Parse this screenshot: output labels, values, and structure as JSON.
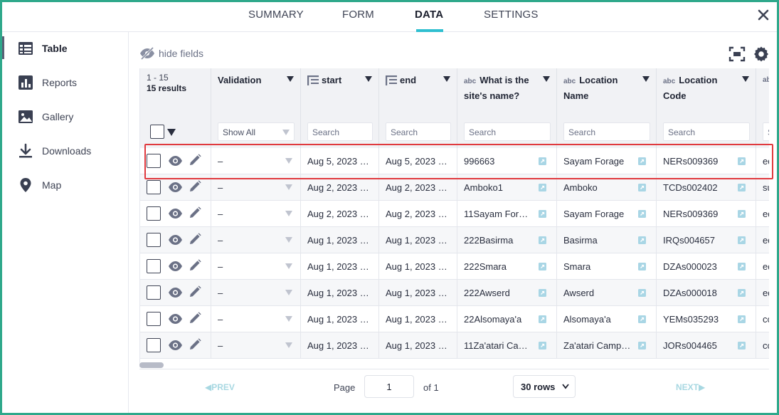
{
  "tabs": [
    {
      "label": "SUMMARY",
      "active": false
    },
    {
      "label": "FORM",
      "active": false
    },
    {
      "label": "DATA",
      "active": true
    },
    {
      "label": "SETTINGS",
      "active": false
    }
  ],
  "sidebar": {
    "items": [
      {
        "label": "Table",
        "icon": "table-icon",
        "active": true
      },
      {
        "label": "Reports",
        "icon": "reports-icon",
        "active": false
      },
      {
        "label": "Gallery",
        "icon": "gallery-icon",
        "active": false
      },
      {
        "label": "Downloads",
        "icon": "download-icon",
        "active": false
      },
      {
        "label": "Map",
        "icon": "map-pin-icon",
        "active": false
      }
    ]
  },
  "toolbar": {
    "hide_fields_label": "hide fields",
    "hide_fields_icon": "eye-off-icon",
    "fullscreen_icon": "fullscreen-icon",
    "settings_icon": "gear-icon"
  },
  "table": {
    "range": "1 - 15",
    "results": "15 results",
    "columns": [
      {
        "key": "validation",
        "title": "Validation",
        "filter": "Show All",
        "type": "select"
      },
      {
        "key": "start",
        "title": "start",
        "filter": "Search",
        "type": "datetime"
      },
      {
        "key": "end",
        "title": "end",
        "filter": "Search",
        "type": "datetime"
      },
      {
        "key": "site_name",
        "title": "What is the site's name?",
        "filter": "Search",
        "type": "text"
      },
      {
        "key": "location_name",
        "title": "Location Name",
        "filter": "Search",
        "type": "text"
      },
      {
        "key": "location_code",
        "title": "Location Code",
        "filter": "Search",
        "type": "text"
      },
      {
        "key": "next",
        "title": "ab",
        "filter": "S",
        "type": "text"
      }
    ],
    "rows": [
      {
        "validation": "–",
        "start": "Aug 5, 2023 1...",
        "end": "Aug 5, 2023 1...",
        "site_name": "996663",
        "location_name": "Sayam Forage",
        "location_code": "NERs009369",
        "next": "ed"
      },
      {
        "validation": "–",
        "start": "Aug 2, 2023 8:...",
        "end": "Aug 2, 2023 8:...",
        "site_name": "Amboko1",
        "location_name": "Amboko",
        "location_code": "TCDs002402",
        "next": "su"
      },
      {
        "validation": "–",
        "start": "Aug 2, 2023 6:...",
        "end": "Aug 2, 2023 6:...",
        "site_name": "11Sayam Forage",
        "location_name": "Sayam Forage",
        "location_code": "NERs009369",
        "next": "ed"
      },
      {
        "validation": "–",
        "start": "Aug 1, 2023 1...",
        "end": "Aug 1, 2023 1...",
        "site_name": "222Basirma",
        "location_name": "Basirma",
        "location_code": "IRQs004657",
        "next": "ed"
      },
      {
        "validation": "–",
        "start": "Aug 1, 2023 7:...",
        "end": "Aug 1, 2023 7:...",
        "site_name": "222Smara",
        "location_name": "Smara",
        "location_code": "DZAs000023",
        "next": "ed"
      },
      {
        "validation": "–",
        "start": "Aug 1, 2023 7:...",
        "end": "Aug 1, 2023 7:...",
        "site_name": "222Awserd",
        "location_name": "Awserd",
        "location_code": "DZAs000018",
        "next": "ed"
      },
      {
        "validation": "–",
        "start": "Aug 1, 2023 6:...",
        "end": "Aug 1, 2023 7:...",
        "site_name": "22Alsomaya'a",
        "location_name": "Alsomaya'a",
        "location_code": "YEMs035293",
        "next": "cc"
      },
      {
        "validation": "–",
        "start": "Aug 1, 2023 6:...",
        "end": "Aug 1, 2023 6:...",
        "site_name": "11Za'atari Cam...",
        "location_name": "Za'atari Camp (...",
        "location_code": "JORs004465",
        "next": "cc"
      }
    ]
  },
  "pagination": {
    "prev_label": "PREV",
    "next_label": "NEXT",
    "page_label": "Page",
    "page_value": "1",
    "of_label": "of 1",
    "rows_label": "30 rows"
  },
  "colors": {
    "accent": "#2fbfd0",
    "frame": "#2fa88b",
    "highlight": "#e0393e"
  }
}
